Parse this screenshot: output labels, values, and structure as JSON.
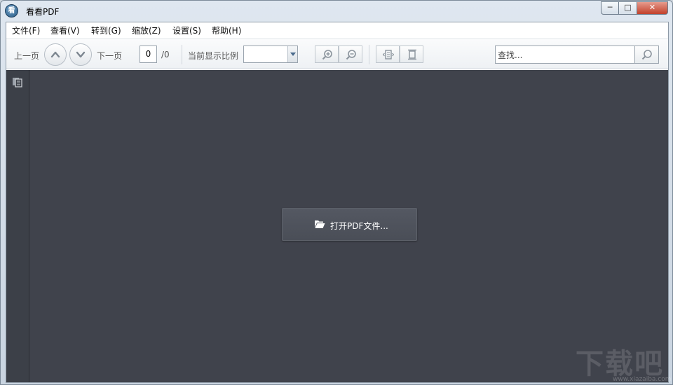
{
  "window": {
    "title": "看看PDF",
    "app_icon_glyph": "看",
    "controls": {
      "minimize": "─",
      "maximize": "□",
      "close": "✕"
    }
  },
  "menu": [
    {
      "id": "file",
      "label": "文件(F)"
    },
    {
      "id": "view",
      "label": "查看(V)"
    },
    {
      "id": "goto",
      "label": "转到(G)"
    },
    {
      "id": "zoom",
      "label": "缩放(Z)"
    },
    {
      "id": "settings",
      "label": "设置(S)"
    },
    {
      "id": "help",
      "label": "帮助(H)"
    }
  ],
  "toolbar": {
    "prev_label": "上一页",
    "next_label": "下一页",
    "page_current": "0",
    "page_total": "/0",
    "zoom_label": "当前显示比例",
    "zoom_value": "",
    "search_placeholder": "查找..."
  },
  "main": {
    "open_button_label": "打开PDF文件..."
  },
  "watermark": {
    "main": "下载吧",
    "sub": "www.xiazaiba.com"
  },
  "colors": {
    "canvas": "#40434c",
    "sidebar": "#3c4048",
    "accent_arrow": "#4a6a8c"
  }
}
